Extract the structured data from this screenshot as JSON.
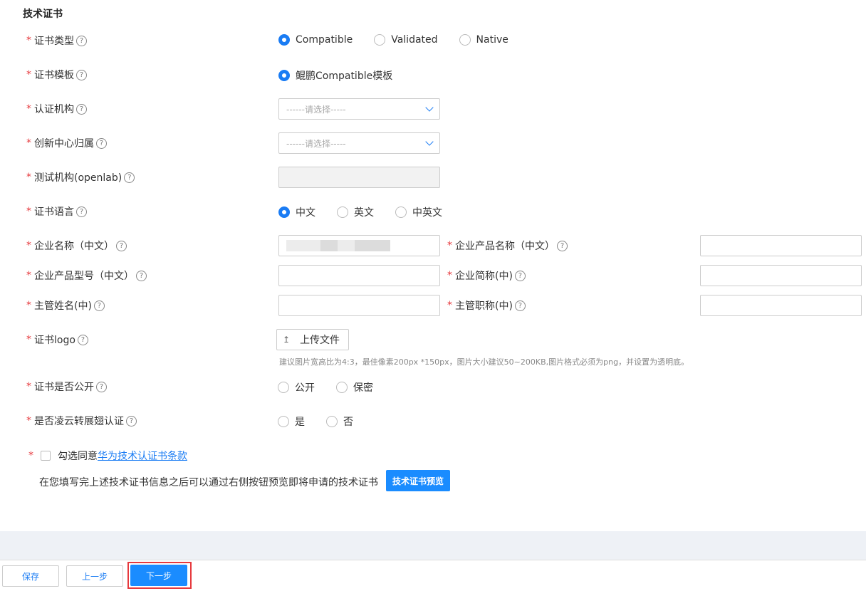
{
  "section_title": "技术证书",
  "help_glyph": "?",
  "required_mark": "*",
  "fields": {
    "cert_type": {
      "label": "证书类型",
      "options": [
        "Compatible",
        "Validated",
        "Native"
      ],
      "selected": "Compatible"
    },
    "cert_template": {
      "label": "证书模板",
      "options": [
        "鲲鹏Compatible模板"
      ],
      "selected": "鲲鹏Compatible模板"
    },
    "cert_authority": {
      "label": "认证机构",
      "placeholder": "------请选择-----"
    },
    "innovation_center": {
      "label": "创新中心归属",
      "placeholder": "------请选择-----"
    },
    "test_org": {
      "label": "测试机构(openlab)",
      "value": ""
    },
    "cert_language": {
      "label": "证书语言",
      "options": [
        "中文",
        "英文",
        "中英文"
      ],
      "selected": "中文"
    },
    "company_name_cn": {
      "label": "企业名称（中文）"
    },
    "product_name_cn": {
      "label": "企业产品名称（中文）",
      "value": ""
    },
    "product_model_cn": {
      "label": "企业产品型号（中文）",
      "value": ""
    },
    "company_abbr_cn": {
      "label": "企业简称(中)",
      "value": ""
    },
    "manager_name_cn": {
      "label": "主管姓名(中)",
      "value": ""
    },
    "manager_title_cn": {
      "label": "主管职称(中)",
      "value": ""
    },
    "cert_logo": {
      "label": "证书logo",
      "upload_label": "上传文件",
      "upload_icon": "upload-icon",
      "hint": "建议图片宽高比为4:3，最佳像素200px *150px，图片大小建议50~200KB,图片格式必须为png，并设置为透明底。"
    },
    "cert_public": {
      "label": "证书是否公开",
      "options": [
        "公开",
        "保密"
      ],
      "selected": ""
    },
    "lingyun": {
      "label": "是否凌云转展翅认证",
      "options": [
        "是",
        "否"
      ],
      "selected": ""
    }
  },
  "agreement": {
    "prefix": "勾选同意",
    "link": "华为技术认证书条款",
    "checked": false
  },
  "preview": {
    "text": "在您填写完上述技术证书信息之后可以通过右侧按钮预览即将申请的技术证书",
    "button": "技术证书预览"
  },
  "footer": {
    "save": "保存",
    "prev": "上一步",
    "next": "下一步"
  },
  "colors": {
    "accent": "#1a7cf4",
    "primary_button": "#1a8cff",
    "required": "#e6393d",
    "highlight_border": "#e6393d"
  }
}
